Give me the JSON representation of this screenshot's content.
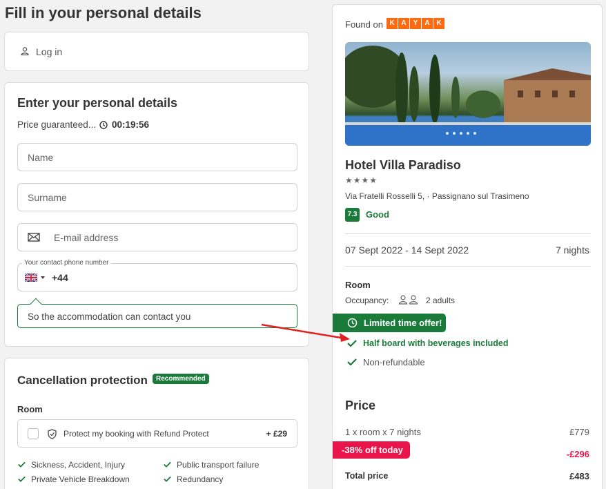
{
  "page_title": "Fill in your personal details",
  "login": {
    "label": "Log in"
  },
  "details": {
    "heading": "Enter your personal details",
    "price_guaranteed": "Price guaranteed...",
    "timer": "00:19:56",
    "name_placeholder": "Name",
    "surname_placeholder": "Surname",
    "email_placeholder": "E-mail address",
    "phone_label": "Your contact phone number",
    "phone_prefix": "+44",
    "tooltip": "So the accommodation can contact you"
  },
  "cancellation": {
    "heading": "Cancellation protection",
    "badge": "Recommended",
    "room_label": "Room",
    "protect_label": "Protect my booking with Refund Protect",
    "protect_price": "+ £29",
    "benefits": [
      "Sickness, Accident, Injury",
      "Public transport failure",
      "Private Vehicle Breakdown",
      "Redundancy"
    ]
  },
  "summary": {
    "found_on": "Found on",
    "kayak_letters": [
      "K",
      "A",
      "Y",
      "A",
      "K"
    ],
    "hotel_name": "Hotel Villa Paradiso",
    "stars": "★★★★",
    "address": "Via Fratelli Rosselli 5, · Passignano sul Trasimeno",
    "score": "7.3",
    "score_label": "Good",
    "dates": "07 Sept 2022 - 14 Sept 2022",
    "nights": "7 nights",
    "room_label": "Room",
    "occupancy_label": "Occupancy:",
    "occupancy_value": "2 adults",
    "offer": "Limited time offer!",
    "board": "Half board with beverages included",
    "refund": "Non-refundable"
  },
  "price": {
    "heading": "Price",
    "line": "1 x room x 7 nights",
    "line_value": "£779",
    "discount_label": "-38% off today",
    "discount_value": "-£296",
    "total_label": "Total price",
    "total_value": "£483"
  },
  "colors": {
    "green": "#1a7a3a",
    "pink": "#e9154a",
    "kayak": "#ff690f",
    "arrow": "#e02020"
  }
}
